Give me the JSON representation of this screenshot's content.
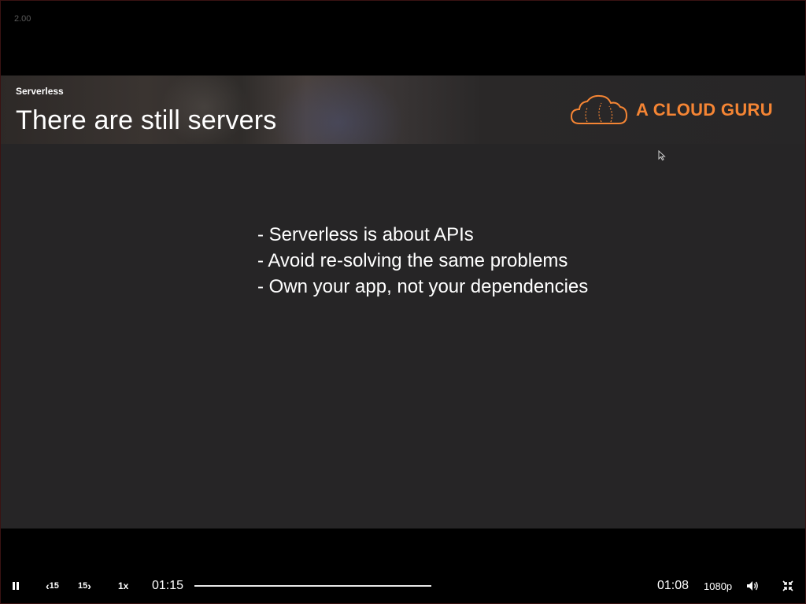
{
  "player": {
    "version_label": "2.00",
    "controls": {
      "play_state": "pause-icon",
      "skip_back_label": "15",
      "skip_forward_label": "15",
      "speed_label": "1x",
      "elapsed_time": "01:15",
      "remaining_time": "01:08",
      "quality_label": "1080p",
      "progress_fraction": 1.0
    }
  },
  "slide": {
    "section": "Serverless",
    "title": "There are still servers",
    "brand": "A CLOUD GURU",
    "bullets": [
      "- Serverless is about APIs",
      "- Avoid re-solving the same problems",
      "- Own your app, not your dependencies"
    ]
  },
  "colors": {
    "brand_orange": "#f58534",
    "slide_background": "#262526",
    "player_background": "#000000"
  }
}
